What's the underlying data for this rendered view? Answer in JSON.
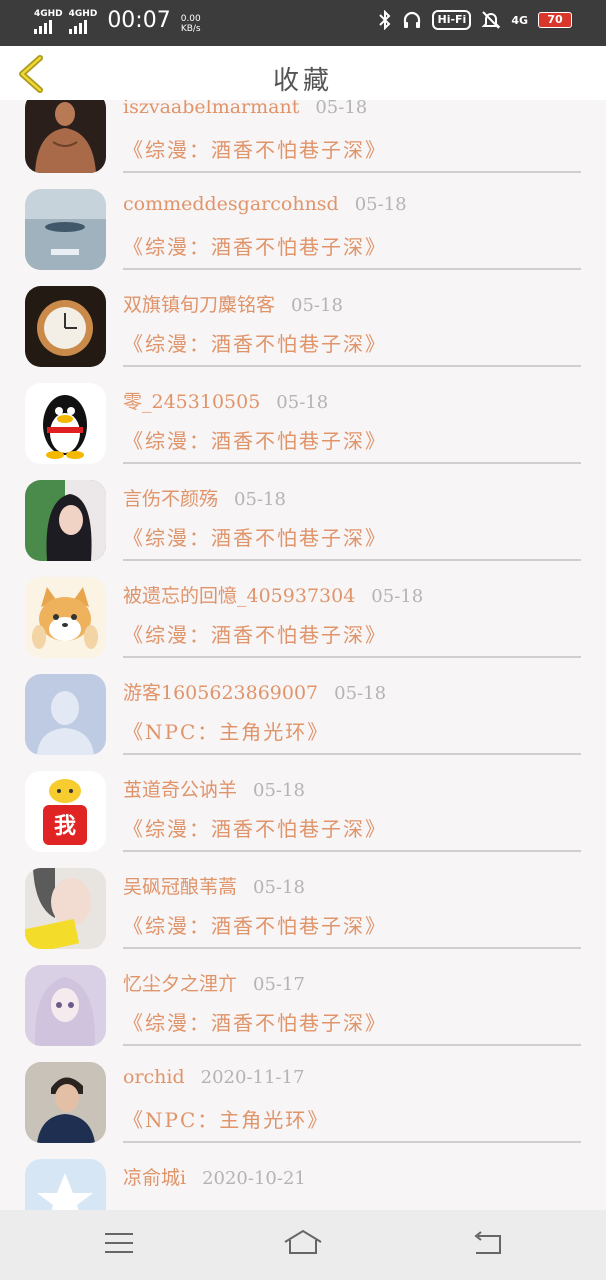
{
  "status": {
    "net1": "4GHD",
    "net2": "4GHD",
    "time": "00:07",
    "speed_value": "0.00",
    "speed_unit": "KB/s",
    "hifi": "Hi-Fi",
    "net3": "4G",
    "battery": "70"
  },
  "header": {
    "title": "收藏"
  },
  "favorites": [
    {
      "name": "iszvaabelmarmant",
      "date": "05-18",
      "work": "《综漫：酒香不怕巷子深》",
      "avatar": "muscle-man"
    },
    {
      "name": "commeddesgarcohnsd",
      "date": "05-18",
      "work": "《综漫：酒香不怕巷子深》",
      "avatar": "water-glass"
    },
    {
      "name": "双旗镇旬刀麋铭客",
      "date": "05-18",
      "work": "《综漫：酒香不怕巷子深》",
      "avatar": "watch"
    },
    {
      "name": "零_245310505",
      "date": "05-18",
      "work": "《综漫：酒香不怕巷子深》",
      "avatar": "penguin"
    },
    {
      "name": "言伤不颜殇",
      "date": "05-18",
      "work": "《综漫：酒香不怕巷子深》",
      "avatar": "girl"
    },
    {
      "name": "被遗忘的回憶_405937304",
      "date": "05-18",
      "work": "《综漫：酒香不怕巷子深》",
      "avatar": "shiba-dog"
    },
    {
      "name": "游客1605623869007",
      "date": "05-18",
      "work": "《NPC：主角光环》",
      "avatar": "default-user"
    },
    {
      "name": "茧道奇公讷羊",
      "date": "05-18",
      "work": "《综漫：酒香不怕巷子深》",
      "avatar": "cat-sign"
    },
    {
      "name": "吴砜冠酿苇蒿",
      "date": "05-18",
      "work": "《综漫：酒香不怕巷子深》",
      "avatar": "girl-card"
    },
    {
      "name": "忆尘夕之浬亣",
      "date": "05-17",
      "work": "《综漫：酒香不怕巷子深》",
      "avatar": "anime-girl"
    },
    {
      "name": "orchid",
      "date": "2020-11-17",
      "work": "《NPC：主角光环》",
      "avatar": "man"
    },
    {
      "name": "凉俞城i",
      "date": "2020-10-21",
      "work": "",
      "avatar": "star-logo"
    }
  ],
  "bottom_nav": {
    "menu": "menu-icon",
    "home": "home-icon",
    "back": "back-icon"
  }
}
